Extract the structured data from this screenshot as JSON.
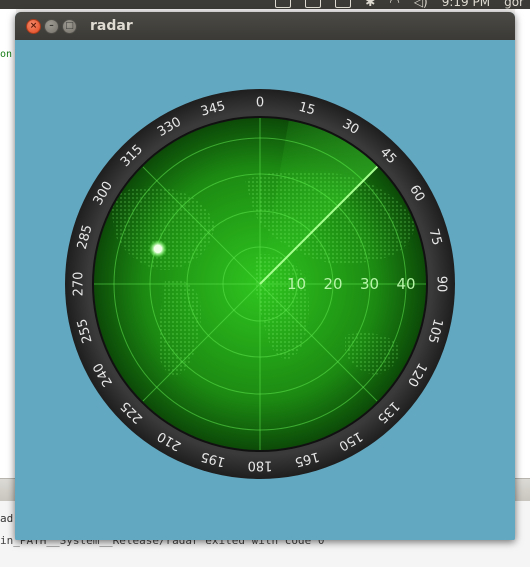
{
  "window": {
    "title": "radar",
    "close_glyph": "×",
    "minimize_glyph": "–",
    "maximize_glyph": "□"
  },
  "top_panel": {
    "clock": "9:19 PM",
    "user": "gor"
  },
  "background": {
    "left_fragment": "on",
    "bottom_tab_fragment": "ad",
    "output_line": "in_PATH__System__Release/radar exited with code 0"
  },
  "radar": {
    "bezel_labels": [
      "0",
      "15",
      "30",
      "45",
      "60",
      "75",
      "90",
      "105",
      "120",
      "135",
      "150",
      "165",
      "180",
      "195",
      "210",
      "225",
      "240",
      "255",
      "270",
      "285",
      "300",
      "315",
      "330",
      "345"
    ],
    "range_labels": [
      "10",
      "20",
      "30",
      "40"
    ],
    "sweep_angle_deg": 45,
    "blip": {
      "bearing_deg": 289,
      "range_fraction": 0.65
    },
    "colors": {
      "background": "#63a8c1",
      "bezel": "#2b2b2b",
      "scope_center": "#2fc51f",
      "scope_edge": "#0c4a08",
      "grid": "#5fe64f",
      "sweep": "#4dff3a",
      "blip": "#d8ffcc"
    }
  }
}
